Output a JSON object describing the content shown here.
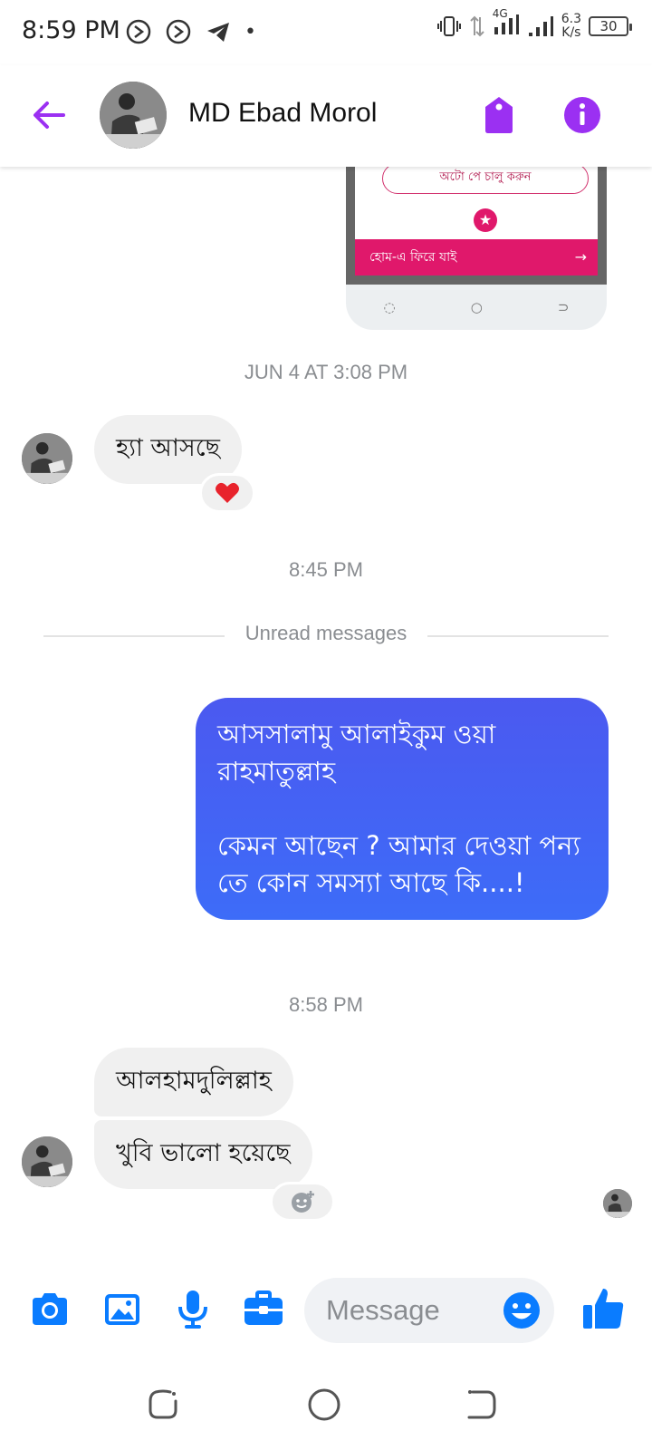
{
  "status_bar": {
    "time": "8:59 PM",
    "network": "4G",
    "speed_value": "6.3",
    "speed_unit": "K/s",
    "battery": "30"
  },
  "header": {
    "contact_name": "MD Ebad Morol"
  },
  "attachment": {
    "autopay_label": "অটো পে চালু করুন",
    "home_label": "হোম-এ ফিরে যাই"
  },
  "messages": {
    "ts1": "JUN 4 AT 3:08 PM",
    "in1": "হ্যা আসছে",
    "in1_reaction": "❤️",
    "ts2": "8:45 PM",
    "unread": "Unread messages",
    "out1": "আসসালামু আলাইকুম ওয়া রাহমাতুল্লাহ\n\nকেমন আছেন ? আমার দেওয়া পন্য তে কোন সমস্যা আছে কি....!",
    "ts3": "8:58 PM",
    "in2": "আলহামদুলিল্লাহ",
    "in3": "খুবি ভালো হয়েছে"
  },
  "composer": {
    "placeholder": "Message"
  },
  "colors": {
    "accent": "#9b30f2",
    "blue": "#0a7cff",
    "bubble_out_top": "#4b59f0",
    "bubble_out_bottom": "#3d6cf8",
    "pink": "#e0186b"
  }
}
